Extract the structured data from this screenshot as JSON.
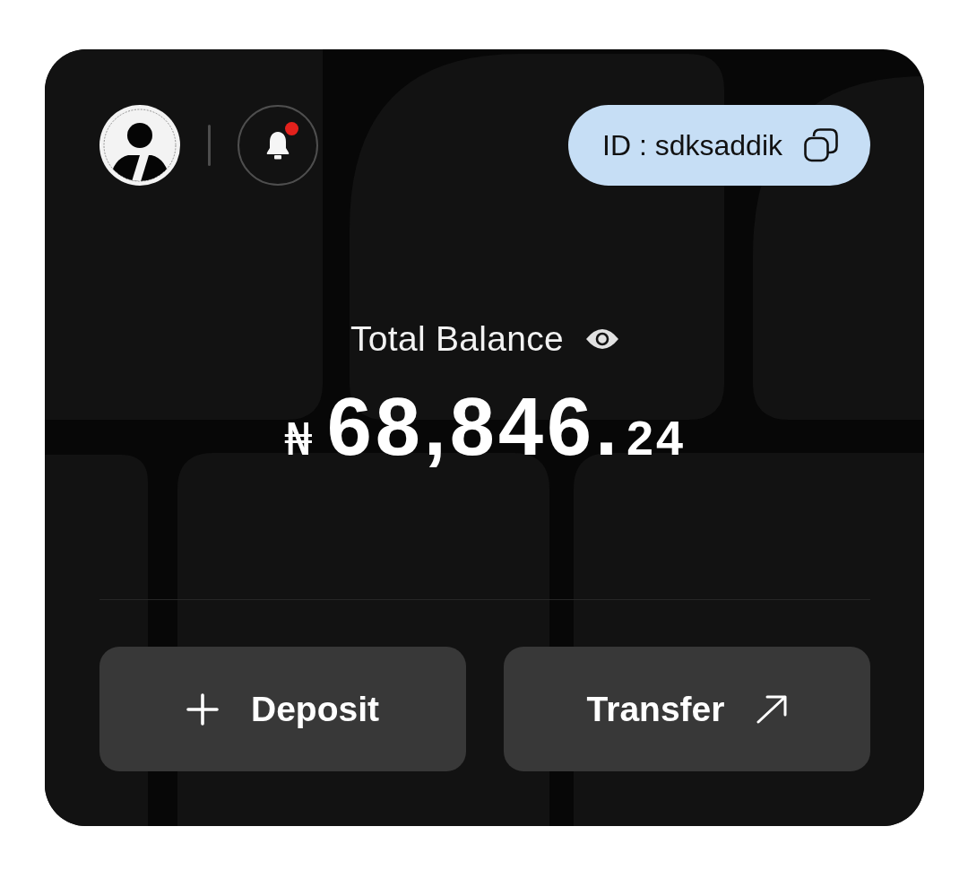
{
  "header": {
    "notifications": {
      "unread": true
    },
    "user_id": "ID : sdksaddik"
  },
  "balance": {
    "label": "Total Balance",
    "currency": "₦",
    "amount": "68,846.",
    "fraction": "24"
  },
  "actions": [
    {
      "label": "Deposit",
      "kind": "add"
    },
    {
      "label": "Transfer",
      "kind": "send"
    }
  ]
}
